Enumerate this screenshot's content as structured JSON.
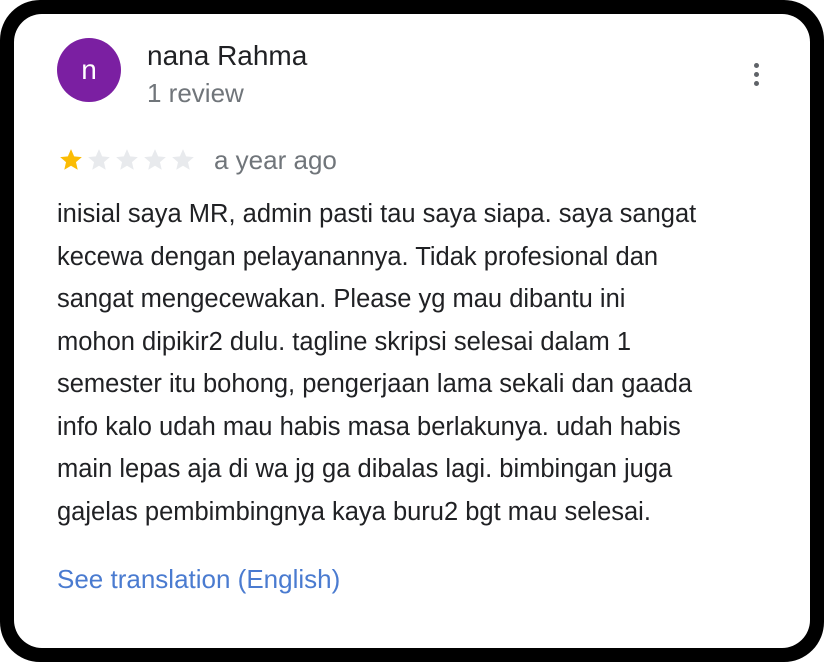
{
  "reviewer": {
    "avatar_letter": "n",
    "avatar_color": "#7b1fa2",
    "name": "nana Rahma",
    "review_count": "1 review"
  },
  "menu": {
    "icon": "more-vert-icon"
  },
  "rating": {
    "value": 1,
    "max": 5,
    "filled_color": "#fbbc04",
    "empty_color": "#e8eaed"
  },
  "review": {
    "time": "a year ago",
    "lines": [
      "inisial saya MR, admin pasti tau saya siapa. saya sangat",
      "kecewa dengan pelayanannya. Tidak profesional dan",
      "sangat mengecewakan. Please yg mau dibantu ini",
      "mohon dipikir2 dulu. tagline skripsi selesai dalam 1",
      "semester itu bohong, pengerjaan lama sekali dan gaada",
      "info kalo udah mau habis masa berlakunya. udah habis",
      "main lepas aja di wa jg ga dibalas lagi. bimbingan juga",
      "gajelas pembimbingnya kaya buru2 bgt mau selesai."
    ]
  },
  "translation": {
    "link_label": "See translation (English)",
    "link_color": "#4a7bd0"
  }
}
